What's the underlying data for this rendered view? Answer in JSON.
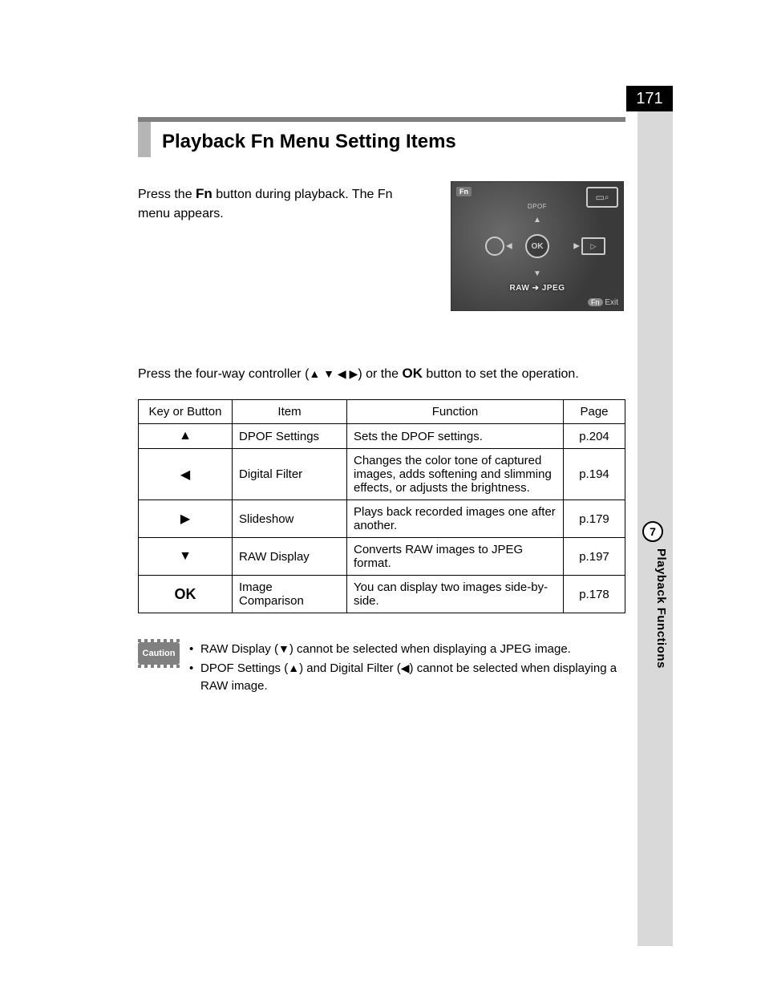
{
  "page_number": "171",
  "chapter_number": "7",
  "side_label": "Playback Functions",
  "heading": "Playback Fn Menu Setting Items",
  "intro_prefix": "Press the ",
  "intro_fn": "Fn",
  "intro_suffix": " button during playback. The Fn menu appears.",
  "lcd": {
    "fn": "Fn",
    "dpof": "DPOF",
    "ok": "OK",
    "raw": "RAW ➔ JPEG",
    "exit_pill": "Fn",
    "exit_text": "Exit",
    "play": "▷"
  },
  "para2_a": "Press the four-way controller (",
  "para2_arrows": "▲ ▼ ◀ ▶",
  "para2_b": ") or the ",
  "para2_ok": "OK",
  "para2_c": " button to set the operation.",
  "table": {
    "headers": {
      "key": "Key or Button",
      "item": "Item",
      "func": "Function",
      "page": "Page"
    },
    "rows": [
      {
        "key": "▲",
        "item": "DPOF Settings",
        "func": "Sets the DPOF settings.",
        "page": "p.204"
      },
      {
        "key": "◀",
        "item": "Digital Filter",
        "func": "Changes the color tone of captured images, adds softening and slimming effects, or adjusts the brightness.",
        "page": "p.194"
      },
      {
        "key": "▶",
        "item": "Slideshow",
        "func": "Plays back recorded images one after another.",
        "page": "p.179"
      },
      {
        "key": "▼",
        "item": "RAW Display",
        "func": "Converts RAW images to JPEG format.",
        "page": "p.197"
      },
      {
        "key": "OK",
        "item": "Image Comparison",
        "func": "You can display two images side-by-side.",
        "page": "p.178"
      }
    ]
  },
  "caution_label": "Caution",
  "caution": {
    "line1_a": "RAW Display (",
    "line1_arrow": "▼",
    "line1_b": ") cannot be selected when displaying a JPEG image.",
    "line2_a": "DPOF Settings (",
    "line2_arrow1": "▲",
    "line2_b": ") and Digital Filter (",
    "line2_arrow2": "◀",
    "line2_c": ") cannot be selected when displaying a RAW image."
  }
}
